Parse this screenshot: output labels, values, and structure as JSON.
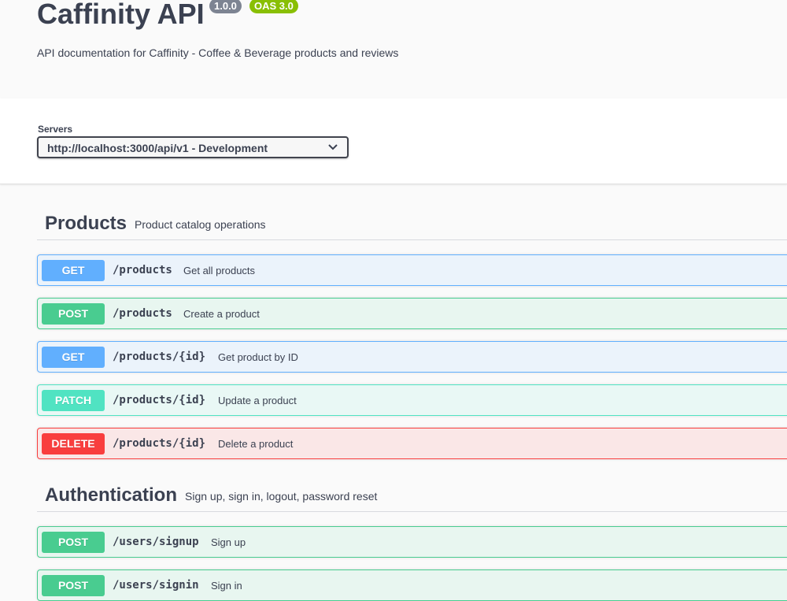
{
  "info": {
    "title": "Caffinity API",
    "version": "1.0.0",
    "oas": "OAS 3.0",
    "description": "API documentation for Caffinity - Coffee & Beverage products and reviews"
  },
  "servers": {
    "label": "Servers",
    "selected": "http://localhost:3000/api/v1 - Development"
  },
  "tags": [
    {
      "name": "Products",
      "description": "Product catalog operations",
      "operations": [
        {
          "method": "GET",
          "path": "/products",
          "summary": "Get all products"
        },
        {
          "method": "POST",
          "path": "/products",
          "summary": "Create a product"
        },
        {
          "method": "GET",
          "path": "/products/{id}",
          "summary": "Get product by ID"
        },
        {
          "method": "PATCH",
          "path": "/products/{id}",
          "summary": "Update a product"
        },
        {
          "method": "DELETE",
          "path": "/products/{id}",
          "summary": "Delete a product"
        }
      ]
    },
    {
      "name": "Authentication",
      "description": "Sign up, sign in, logout, password reset",
      "operations": [
        {
          "method": "POST",
          "path": "/users/signup",
          "summary": "Sign up"
        },
        {
          "method": "POST",
          "path": "/users/signin",
          "summary": "Sign in"
        }
      ]
    }
  ],
  "colors": {
    "get": "#61affe",
    "post": "#49cc90",
    "patch": "#50e3c2",
    "delete": "#f93e3e",
    "text": "#3b4151"
  }
}
